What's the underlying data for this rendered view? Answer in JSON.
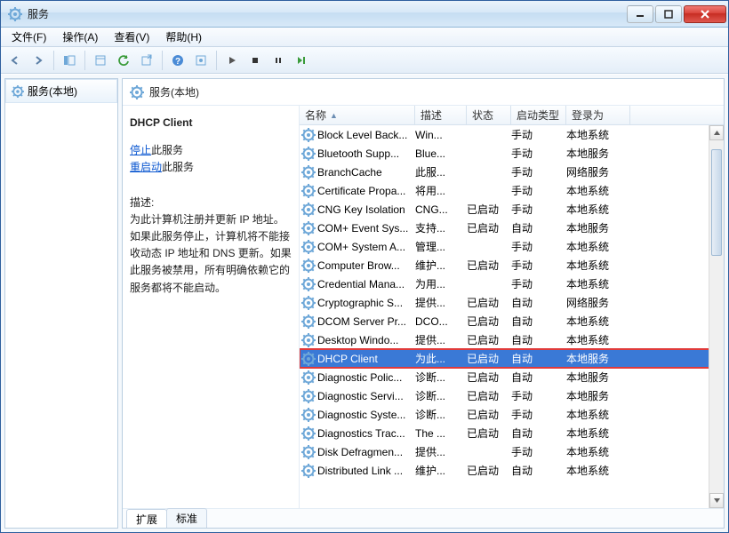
{
  "window": {
    "title": "服务"
  },
  "menu": {
    "file": "文件(F)",
    "action": "操作(A)",
    "view": "查看(V)",
    "help": "帮助(H)"
  },
  "tree": {
    "root": "服务(本地)"
  },
  "panel_header": "服务(本地)",
  "detail": {
    "service_name": "DHCP Client",
    "stop_link": "停止",
    "stop_suffix": "此服务",
    "restart_link": "重启动",
    "restart_suffix": "此服务",
    "desc_label": "描述:",
    "desc": "为此计算机注册并更新 IP 地址。如果此服务停止，计算机将不能接收动态 IP 地址和 DNS 更新。如果此服务被禁用，所有明确依赖它的服务都将不能启动。"
  },
  "columns": {
    "name": "名称",
    "desc": "描述",
    "status": "状态",
    "startup": "启动类型",
    "logon": "登录为"
  },
  "rows": [
    {
      "name": "Block Level Back...",
      "desc": "Win...",
      "status": "",
      "startup": "手动",
      "logon": "本地系统"
    },
    {
      "name": "Bluetooth Supp...",
      "desc": "Blue...",
      "status": "",
      "startup": "手动",
      "logon": "本地服务"
    },
    {
      "name": "BranchCache",
      "desc": "此服...",
      "status": "",
      "startup": "手动",
      "logon": "网络服务"
    },
    {
      "name": "Certificate Propa...",
      "desc": "将用...",
      "status": "",
      "startup": "手动",
      "logon": "本地系统"
    },
    {
      "name": "CNG Key Isolation",
      "desc": "CNG...",
      "status": "已启动",
      "startup": "手动",
      "logon": "本地系统"
    },
    {
      "name": "COM+ Event Sys...",
      "desc": "支持...",
      "status": "已启动",
      "startup": "自动",
      "logon": "本地服务"
    },
    {
      "name": "COM+ System A...",
      "desc": "管理...",
      "status": "",
      "startup": "手动",
      "logon": "本地系统"
    },
    {
      "name": "Computer Brow...",
      "desc": "维护...",
      "status": "已启动",
      "startup": "手动",
      "logon": "本地系统"
    },
    {
      "name": "Credential Mana...",
      "desc": "为用...",
      "status": "",
      "startup": "手动",
      "logon": "本地系统"
    },
    {
      "name": "Cryptographic S...",
      "desc": "提供...",
      "status": "已启动",
      "startup": "自动",
      "logon": "网络服务"
    },
    {
      "name": "DCOM Server Pr...",
      "desc": "DCO...",
      "status": "已启动",
      "startup": "自动",
      "logon": "本地系统"
    },
    {
      "name": "Desktop Windo...",
      "desc": "提供...",
      "status": "已启动",
      "startup": "自动",
      "logon": "本地系统"
    },
    {
      "name": "DHCP Client",
      "desc": "为此...",
      "status": "已启动",
      "startup": "自动",
      "logon": "本地服务",
      "selected": true,
      "highlight": true
    },
    {
      "name": "Diagnostic Polic...",
      "desc": "诊断...",
      "status": "已启动",
      "startup": "自动",
      "logon": "本地服务"
    },
    {
      "name": "Diagnostic Servi...",
      "desc": "诊断...",
      "status": "已启动",
      "startup": "手动",
      "logon": "本地服务"
    },
    {
      "name": "Diagnostic Syste...",
      "desc": "诊断...",
      "status": "已启动",
      "startup": "手动",
      "logon": "本地系统"
    },
    {
      "name": "Diagnostics Trac...",
      "desc": "The ...",
      "status": "已启动",
      "startup": "自动",
      "logon": "本地系统"
    },
    {
      "name": "Disk Defragmen...",
      "desc": "提供...",
      "status": "",
      "startup": "手动",
      "logon": "本地系统"
    },
    {
      "name": "Distributed Link ...",
      "desc": "维护...",
      "status": "已启动",
      "startup": "自动",
      "logon": "本地系统"
    }
  ],
  "tabs": {
    "extended": "扩展",
    "standard": "标准"
  }
}
